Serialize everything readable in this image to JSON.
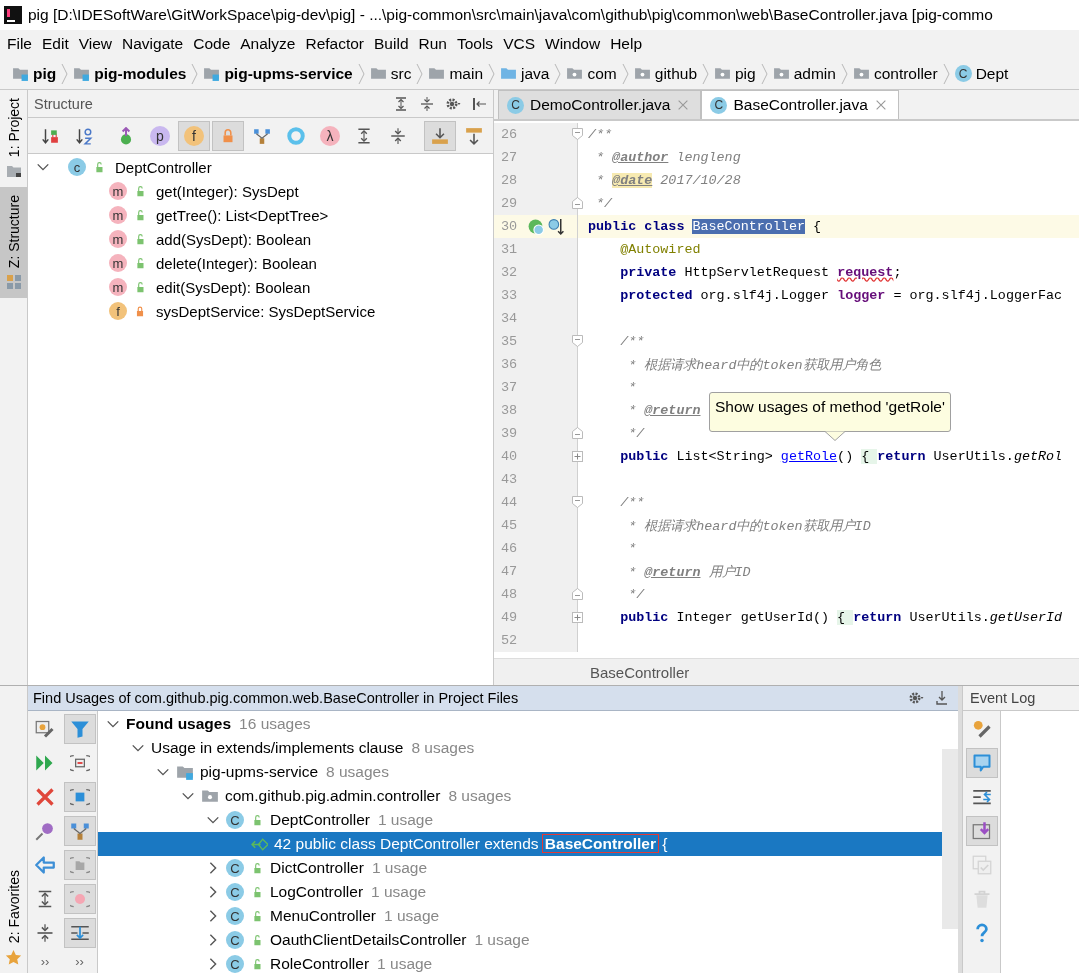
{
  "window": {
    "title": "pig [D:\\IDESoftWare\\GitWorkSpace\\pig-dev\\pig] - ...\\pig-common\\src\\main\\java\\com\\github\\pig\\common\\web\\BaseController.java [pig-commo"
  },
  "menu": [
    "File",
    "Edit",
    "View",
    "Navigate",
    "Code",
    "Analyze",
    "Refactor",
    "Build",
    "Run",
    "Tools",
    "VCS",
    "Window",
    "Help"
  ],
  "breadcrumbs": [
    {
      "label": "pig",
      "kind": "module",
      "bold": true
    },
    {
      "label": "pig-modules",
      "kind": "module",
      "bold": true
    },
    {
      "label": "pig-upms-service",
      "kind": "module",
      "bold": true
    },
    {
      "label": "src",
      "kind": "folder",
      "bold": false
    },
    {
      "label": "main",
      "kind": "folder",
      "bold": false
    },
    {
      "label": "java",
      "kind": "source",
      "bold": false
    },
    {
      "label": "com",
      "kind": "package",
      "bold": false
    },
    {
      "label": "github",
      "kind": "package",
      "bold": false
    },
    {
      "label": "pig",
      "kind": "package",
      "bold": false
    },
    {
      "label": "admin",
      "kind": "package",
      "bold": false
    },
    {
      "label": "controller",
      "kind": "package",
      "bold": false
    },
    {
      "label": "Dept",
      "kind": "class",
      "glyph": "C",
      "bold": false
    }
  ],
  "left_stripe": [
    {
      "label": "1: Project",
      "kind": "project",
      "selected": false
    },
    {
      "label": "Z: Structure",
      "kind": "structure",
      "selected": true
    }
  ],
  "structure": {
    "title": "Structure",
    "header_tools": [
      {
        "kind": "expand"
      },
      {
        "kind": "collapse"
      },
      {
        "kind": "settings"
      },
      {
        "kind": "hide"
      }
    ],
    "toolbar": [
      {
        "kind": "sort-visibility",
        "pressed": false
      },
      {
        "kind": "sort-alpha",
        "pressed": false
      },
      {
        "kind": "inherited",
        "pressed": false
      },
      {
        "kind": "badge",
        "glyph": "p",
        "color": "#c9b8ef",
        "pressed": false
      },
      {
        "kind": "badge",
        "glyph": "f",
        "color": "#f2c27a",
        "pressed": true
      },
      {
        "kind": "lock",
        "pressed": true
      },
      {
        "kind": "hierarchy",
        "pressed": false
      },
      {
        "kind": "ring",
        "pressed": false
      },
      {
        "kind": "badge",
        "glyph": "λ",
        "color": "#f5b3bd",
        "pressed": false
      },
      {
        "kind": "expand",
        "pressed": false
      },
      {
        "kind": "collapse",
        "pressed": false
      },
      {
        "kind": "scroll-to",
        "pressed": true
      },
      {
        "kind": "scroll-from",
        "pressed": false
      }
    ],
    "tree": {
      "label": "DeptController",
      "glyph": "c",
      "color": "#8bcbe6",
      "private": false,
      "expanded": true,
      "children": [
        {
          "label": "get(Integer): SysDept",
          "glyph": "m",
          "color": "#f5b3bd",
          "private": false
        },
        {
          "label": "getTree(): List<DeptTree>",
          "glyph": "m",
          "color": "#f5b3bd",
          "private": false
        },
        {
          "label": "add(SysDept): Boolean",
          "glyph": "m",
          "color": "#f5b3bd",
          "private": false
        },
        {
          "label": "delete(Integer): Boolean",
          "glyph": "m",
          "color": "#f5b3bd",
          "private": false
        },
        {
          "label": "edit(SysDept): Boolean",
          "glyph": "m",
          "color": "#f5b3bd",
          "private": false
        },
        {
          "label": "sysDeptService: SysDeptService",
          "glyph": "f",
          "color": "#f2c27a",
          "private": true
        }
      ]
    }
  },
  "editor": {
    "tabs": [
      {
        "label": "DemoController.java",
        "glyph": "C",
        "selected": false
      },
      {
        "label": "BaseController.java",
        "glyph": "C",
        "selected": true
      }
    ],
    "lines": [
      {
        "number": "26",
        "fold": {
          "kind": "start"
        },
        "tokens": [
          {
            "kind": "comment",
            "text": "/**"
          }
        ]
      },
      {
        "number": "27",
        "tokens": [
          {
            "kind": "comment",
            "text": " * "
          },
          {
            "kind": "doctag",
            "text": "@author"
          },
          {
            "kind": "comment",
            "text": " lengleng"
          }
        ]
      },
      {
        "number": "28",
        "tokens": [
          {
            "kind": "comment",
            "text": " * "
          },
          {
            "kind": "doctag-marked",
            "text": "@date"
          },
          {
            "kind": "comment",
            "text": " 2017/10/28"
          }
        ]
      },
      {
        "number": "29",
        "fold": {
          "kind": "end"
        },
        "tokens": [
          {
            "kind": "comment",
            "text": " */"
          }
        ]
      },
      {
        "number": "30",
        "current": true,
        "gutter": [
          {
            "kind": "implemented"
          },
          {
            "kind": "overridden"
          }
        ],
        "tokens": [
          {
            "kind": "keyword",
            "text": "public class "
          },
          {
            "kind": "selected",
            "text": "BaseController"
          },
          {
            "kind": "plain",
            "text": " {"
          }
        ]
      },
      {
        "number": "31",
        "tokens": [
          {
            "kind": "annotation",
            "text": "    @Autowired"
          }
        ]
      },
      {
        "number": "32",
        "tokens": [
          {
            "kind": "keyword",
            "text": "    private"
          },
          {
            "kind": "plain",
            "text": " HttpServletRequest "
          },
          {
            "kind": "field-error",
            "text": "request"
          },
          {
            "kind": "plain",
            "text": ";"
          }
        ]
      },
      {
        "number": "33",
        "tokens": [
          {
            "kind": "keyword",
            "text": "    protected"
          },
          {
            "kind": "plain",
            "text": " org.slf4j.Logger "
          },
          {
            "kind": "field",
            "text": "logger"
          },
          {
            "kind": "plain",
            "text": " = org.slf4j.LoggerFac"
          }
        ]
      },
      {
        "number": "34"
      },
      {
        "number": "35",
        "fold": {
          "kind": "start"
        },
        "tokens": [
          {
            "kind": "comment",
            "text": "    /**"
          }
        ]
      },
      {
        "number": "36",
        "tokens": [
          {
            "kind": "comment",
            "text": "     * 根据请求heard中的token获取用户角色"
          }
        ]
      },
      {
        "number": "37",
        "tokens": [
          {
            "kind": "comment",
            "text": "     *"
          }
        ]
      },
      {
        "number": "38",
        "tokens": [
          {
            "kind": "comment",
            "text": "     * "
          },
          {
            "kind": "doctag",
            "text": "@return"
          }
        ]
      },
      {
        "number": "39",
        "fold": {
          "kind": "end"
        },
        "tokens": [
          {
            "kind": "comment",
            "text": "     */"
          }
        ]
      },
      {
        "number": "40",
        "fold": {
          "kind": "collapsed"
        },
        "tokens": [
          {
            "kind": "keyword",
            "text": "    public"
          },
          {
            "kind": "plain",
            "text": " List<String> "
          },
          {
            "kind": "link",
            "text": "getRole"
          },
          {
            "kind": "plain",
            "text": "() "
          },
          {
            "kind": "folded",
            "text": "{ "
          },
          {
            "kind": "keyword",
            "text": "return"
          },
          {
            "kind": "plain",
            "text": " UserUtils."
          },
          {
            "kind": "static-call",
            "text": "getRol"
          }
        ]
      },
      {
        "number": "43"
      },
      {
        "number": "44",
        "fold": {
          "kind": "start"
        },
        "tokens": [
          {
            "kind": "comment",
            "text": "    /**"
          }
        ]
      },
      {
        "number": "45",
        "tokens": [
          {
            "kind": "comment",
            "text": "     * 根据请求heard中的token获取用户ID"
          }
        ]
      },
      {
        "number": "46",
        "tokens": [
          {
            "kind": "comment",
            "text": "     *"
          }
        ]
      },
      {
        "number": "47",
        "tokens": [
          {
            "kind": "comment",
            "text": "     * "
          },
          {
            "kind": "doctag",
            "text": "@return"
          },
          {
            "kind": "comment",
            "text": " 用户ID"
          }
        ]
      },
      {
        "number": "48",
        "fold": {
          "kind": "end"
        },
        "tokens": [
          {
            "kind": "comment",
            "text": "     */"
          }
        ]
      },
      {
        "number": "49",
        "fold": {
          "kind": "collapsed"
        },
        "tokens": [
          {
            "kind": "keyword",
            "text": "    public"
          },
          {
            "kind": "plain",
            "text": " Integer getUserId() "
          },
          {
            "kind": "folded",
            "text": "{ "
          },
          {
            "kind": "keyword",
            "text": "return"
          },
          {
            "kind": "plain",
            "text": " UserUtils."
          },
          {
            "kind": "static-call",
            "text": "getUserId"
          }
        ]
      },
      {
        "number": "52"
      }
    ],
    "tooltip": "Show usages of method 'getRole'",
    "breadcrumb": "BaseController"
  },
  "find_usages": {
    "title": "Find Usages of com.github.pig.common.web.BaseController in Project Files",
    "header_tools": [
      {
        "kind": "settings"
      },
      {
        "kind": "pin-bottom"
      }
    ],
    "toolbar_left": [
      {
        "kind": "rerun-settings",
        "pressed": false
      },
      {
        "kind": "run-again",
        "pressed": false
      },
      {
        "kind": "close",
        "pressed": false
      },
      {
        "kind": "pin",
        "pressed": false
      },
      {
        "kind": "back",
        "pressed": false
      },
      {
        "kind": "expand",
        "pressed": false
      },
      {
        "kind": "collapse",
        "pressed": false
      }
    ],
    "toolbar_right": [
      {
        "kind": "filter",
        "pressed": true
      },
      {
        "kind": "preview",
        "pressed": false
      },
      {
        "kind": "stop",
        "pressed": true
      },
      {
        "kind": "hierarchy",
        "pressed": true
      },
      {
        "kind": "folder",
        "pressed": true
      },
      {
        "kind": "method",
        "pressed": true
      },
      {
        "kind": "flatten",
        "pressed": true
      }
    ],
    "overflow": [
      "››",
      "››"
    ],
    "tree": [
      {
        "label": "Found usages",
        "count": "16 usages",
        "kind": "root",
        "expanded": true,
        "selected": false,
        "children": [
          {
            "label": "Usage in extends/implements clause",
            "count": "8 usages",
            "expanded": true,
            "selected": false,
            "children": [
              {
                "label": "pig-upms-service",
                "count": "8 usages",
                "kind": "module",
                "expanded": true,
                "selected": false,
                "children": [
                  {
                    "label": "com.github.pig.admin.controller",
                    "count": "8 usages",
                    "kind": "package",
                    "expanded": true,
                    "selected": false,
                    "children": [
                      {
                        "label": "DeptController",
                        "count": "1 usage",
                        "kind": "class",
                        "glyph": "C",
                        "expanded": true,
                        "selected": false,
                        "children": [
                          {
                            "label": "42 public class DeptController extends **BaseController** {",
                            "kind": "usage",
                            "selected": true
                          }
                        ]
                      },
                      {
                        "label": "DictController",
                        "count": "1 usage",
                        "kind": "class",
                        "glyph": "C",
                        "expanded": false,
                        "selected": false
                      },
                      {
                        "label": "LogController",
                        "count": "1 usage",
                        "kind": "class",
                        "glyph": "C",
                        "expanded": false,
                        "selected": false
                      },
                      {
                        "label": "MenuController",
                        "count": "1 usage",
                        "kind": "class",
                        "glyph": "C",
                        "expanded": false,
                        "selected": false
                      },
                      {
                        "label": "OauthClientDetailsController",
                        "count": "1 usage",
                        "kind": "class",
                        "glyph": "C",
                        "expanded": false,
                        "selected": false
                      },
                      {
                        "label": "RoleController",
                        "count": "1 usage",
                        "kind": "class",
                        "glyph": "C",
                        "expanded": false,
                        "selected": false
                      }
                    ]
                  }
                ]
              }
            ]
          }
        ]
      }
    ]
  },
  "favorites": {
    "label": "2: Favorites"
  },
  "event_log": {
    "title": "Event Log",
    "toolbar": [
      {
        "kind": "wrench",
        "pressed": false,
        "disabled": false
      },
      {
        "kind": "chat",
        "pressed": true,
        "disabled": false
      },
      {
        "kind": "settings-lines",
        "pressed": false,
        "disabled": false
      },
      {
        "kind": "import",
        "pressed": true,
        "disabled": false
      },
      {
        "kind": "check-copy",
        "pressed": false,
        "disabled": true
      },
      {
        "kind": "trash",
        "pressed": false,
        "disabled": true
      },
      {
        "kind": "help",
        "pressed": false,
        "disabled": false
      }
    ]
  }
}
